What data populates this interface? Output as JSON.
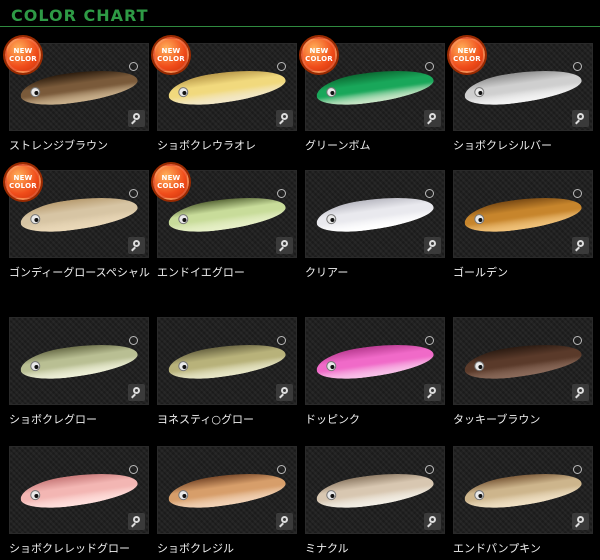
{
  "header": {
    "title": "COLOR CHART"
  },
  "badge": {
    "line1": "NEW",
    "line2": "COLOR"
  },
  "colors": [
    {
      "label": "ストレンジブラウン",
      "new": true,
      "body": "#7a5a3a",
      "belly": "#c9b08c",
      "accent": "#2c1c0e"
    },
    {
      "label": "ショボクレウラオレ",
      "new": true,
      "body": "#f1d97d",
      "belly": "#f3e8c8",
      "accent": "#b9994a"
    },
    {
      "label": "グリーンボム",
      "new": true,
      "body": "#19a75a",
      "belly": "#c9e6c7",
      "accent": "#0b6b33"
    },
    {
      "label": "ショボクレシルバー",
      "new": true,
      "body": "#cfcfcf",
      "belly": "#f4f4f4",
      "accent": "#8e8e8e"
    },
    {
      "label": "ゴンディーグロースペシャル",
      "new": true,
      "body": "#d7c5a4",
      "belly": "#ead8b8",
      "accent": "#b89c70"
    },
    {
      "label": "エンドイエグロー",
      "new": true,
      "body": "#c8dc9a",
      "belly": "#e7f0c8",
      "accent": "#5c6b3a"
    },
    {
      "label": "クリアー",
      "new": false,
      "body": "#e9e9ee",
      "belly": "#ffffff",
      "accent": "#b9b9c2"
    },
    {
      "label": "ゴールデン",
      "new": false,
      "body": "#c7852c",
      "belly": "#f0c27a",
      "accent": "#7a4a14"
    },
    {
      "label": "ショボクレグロー",
      "new": false,
      "body": "#b9bf93",
      "belly": "#eef0d8",
      "accent": "#6c6f4a"
    },
    {
      "label": "ヨネスティ○グロー",
      "new": false,
      "body": "#b8b27a",
      "belly": "#e8e7c8",
      "accent": "#6a6542"
    },
    {
      "label": "ドッピンク",
      "new": false,
      "body": "#f06ac8",
      "belly": "#f8c2e9",
      "accent": "#b93b91"
    },
    {
      "label": "タッキーブラウン",
      "new": false,
      "body": "#5a3a2a",
      "belly": "#8a6a5a",
      "accent": "#2b1b12"
    },
    {
      "label": "ショボクレレッドグロー",
      "new": false,
      "body": "#f3b6b3",
      "belly": "#ffe0dd",
      "accent": "#c87979"
    },
    {
      "label": "ショボクレジル",
      "new": false,
      "body": "#d79e6a",
      "belly": "#f2d3b7",
      "accent": "#7a4a2a"
    },
    {
      "label": "ミナクル",
      "new": false,
      "body": "#d8c7b1",
      "belly": "#f3efe6",
      "accent": "#8f7c66"
    },
    {
      "label": "エンドパンプキン",
      "new": false,
      "body": "#cdb58c",
      "belly": "#efe0c4",
      "accent": "#7d5c3b"
    }
  ]
}
